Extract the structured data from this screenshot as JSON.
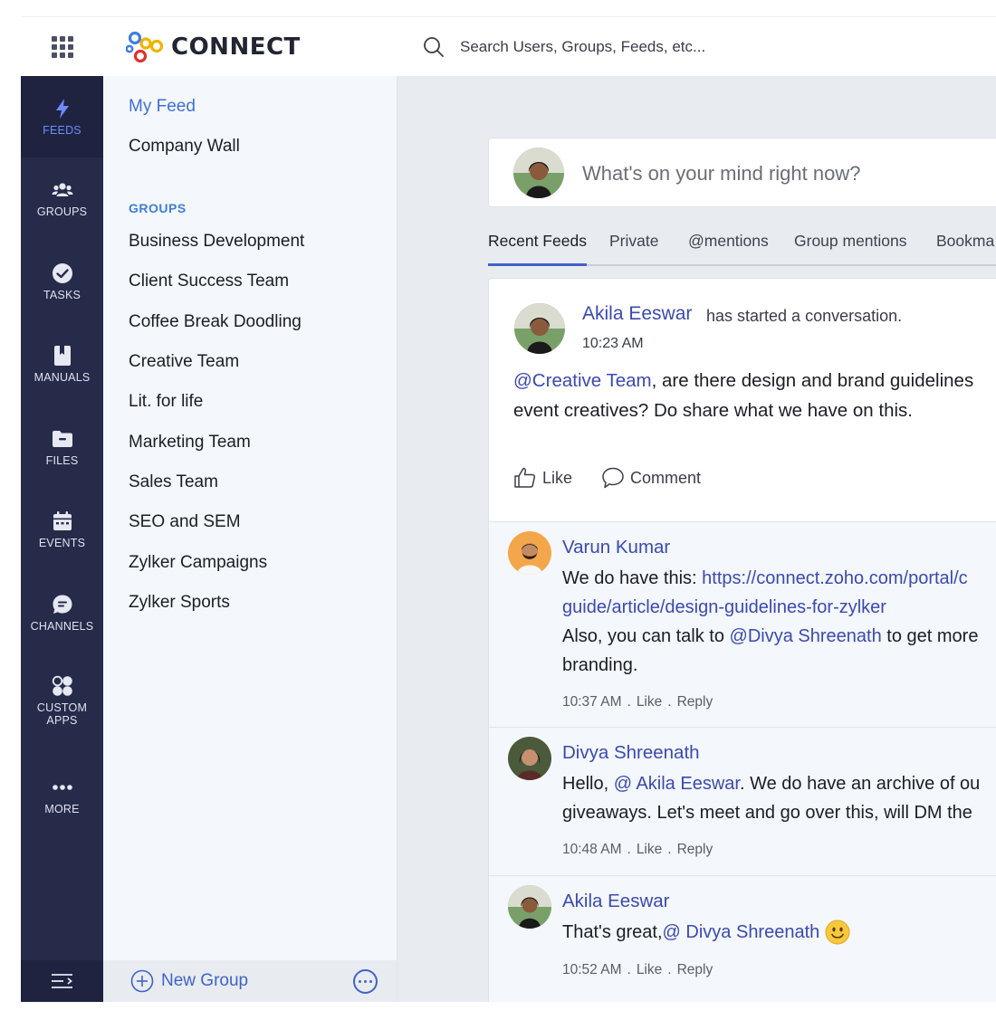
{
  "app": {
    "name": "CONNECT"
  },
  "search": {
    "placeholder": "Search Users, Groups, Feeds, etc..."
  },
  "rail": {
    "items": [
      {
        "label": "FEEDS",
        "icon": "bolt-icon"
      },
      {
        "label": "GROUPS",
        "icon": "people-icon"
      },
      {
        "label": "TASKS",
        "icon": "check-circle-icon"
      },
      {
        "label": "MANUALS",
        "icon": "book-icon"
      },
      {
        "label": "FILES",
        "icon": "folder-icon"
      },
      {
        "label": "EVENTS",
        "icon": "calendar-icon"
      },
      {
        "label": "CHANNELS",
        "icon": "chat-bubble-icon"
      },
      {
        "label": "CUSTOM APPS",
        "icon": "apps-icon"
      },
      {
        "label": "MORE",
        "icon": "dots-icon"
      }
    ]
  },
  "sidebar": {
    "my_feed": "My Feed",
    "company_wall": "Company Wall",
    "groups_heading": "GROUPS",
    "groups": [
      "Business Development",
      "Client Success Team",
      "Coffee Break Doodling",
      "Creative Team",
      "Lit. for life",
      "Marketing Team",
      "Sales Team",
      "SEO and SEM",
      "Zylker Campaigns",
      "Zylker Sports"
    ],
    "new_group": "New Group"
  },
  "compose": {
    "placeholder": "What's on your mind right now?"
  },
  "tabs": [
    "Recent Feeds",
    "Private",
    "@mentions",
    "Group mentions",
    "Bookma"
  ],
  "post": {
    "author": "Akila Eeswar",
    "action": "has started a conversation.",
    "time": "10:23 AM",
    "mention": "@Creative Team",
    "line1_rest": ", are there design and brand guidelines",
    "line2": "event creatives? Do share what we have on this.",
    "like": "Like",
    "comment": "Comment"
  },
  "comments": [
    {
      "author": "Varun Kumar",
      "line1_prefix": "We do have this: ",
      "line1_link": "https://connect.zoho.com/portal/c",
      "line2_link": "guide/article/design-guidelines-for-zylker",
      "line3_prefix": "Also, you can talk to ",
      "line3_mention": "@Divya Shreenath",
      "line3_rest": " to get more",
      "line4": "branding.",
      "time": "10:37 AM",
      "like": "Like",
      "reply": "Reply"
    },
    {
      "author": "Divya Shreenath",
      "line1_prefix": "Hello, ",
      "line1_mention": "@ Akila Eeswar",
      "line1_rest": ". We do have an archive of ou",
      "line2": "giveaways. Let's meet and go over this, will DM the",
      "time": "10:48 AM",
      "like": "Like",
      "reply": "Reply"
    },
    {
      "author": "Akila Eeswar",
      "line1_prefix": "That's great, ",
      "line1_mention": "@ Divya Shreenath",
      "emoji": "smile-emoji",
      "time": "10:52 AM",
      "like": "Like",
      "reply": "Reply"
    }
  ],
  "meta": {
    "separator": "."
  },
  "colors": {
    "rail_bg": "#272b4a",
    "accent": "#3f63c8",
    "link": "#3a4ab0",
    "active_rail": "#6d8bff"
  }
}
